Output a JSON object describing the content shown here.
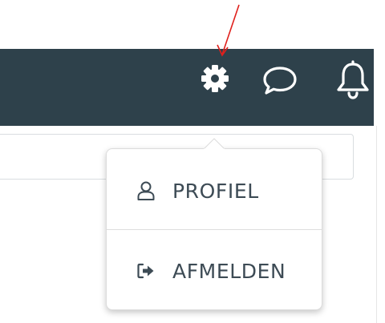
{
  "colors": {
    "topbar_background": "#2e414b",
    "icon_color": "#ffffff",
    "menu_text": "#3d4b55",
    "annotation": "#e0201c"
  },
  "header": {
    "icons": [
      "gear-icon",
      "chat-bubble-icon",
      "bell-icon"
    ]
  },
  "dropdown": {
    "items": [
      {
        "label": "PROFIEL",
        "icon": "user-icon"
      },
      {
        "label": "AFMELDEN",
        "icon": "sign-out-icon"
      }
    ]
  },
  "annotation": {
    "type": "arrow",
    "points_to": "settings-button"
  }
}
